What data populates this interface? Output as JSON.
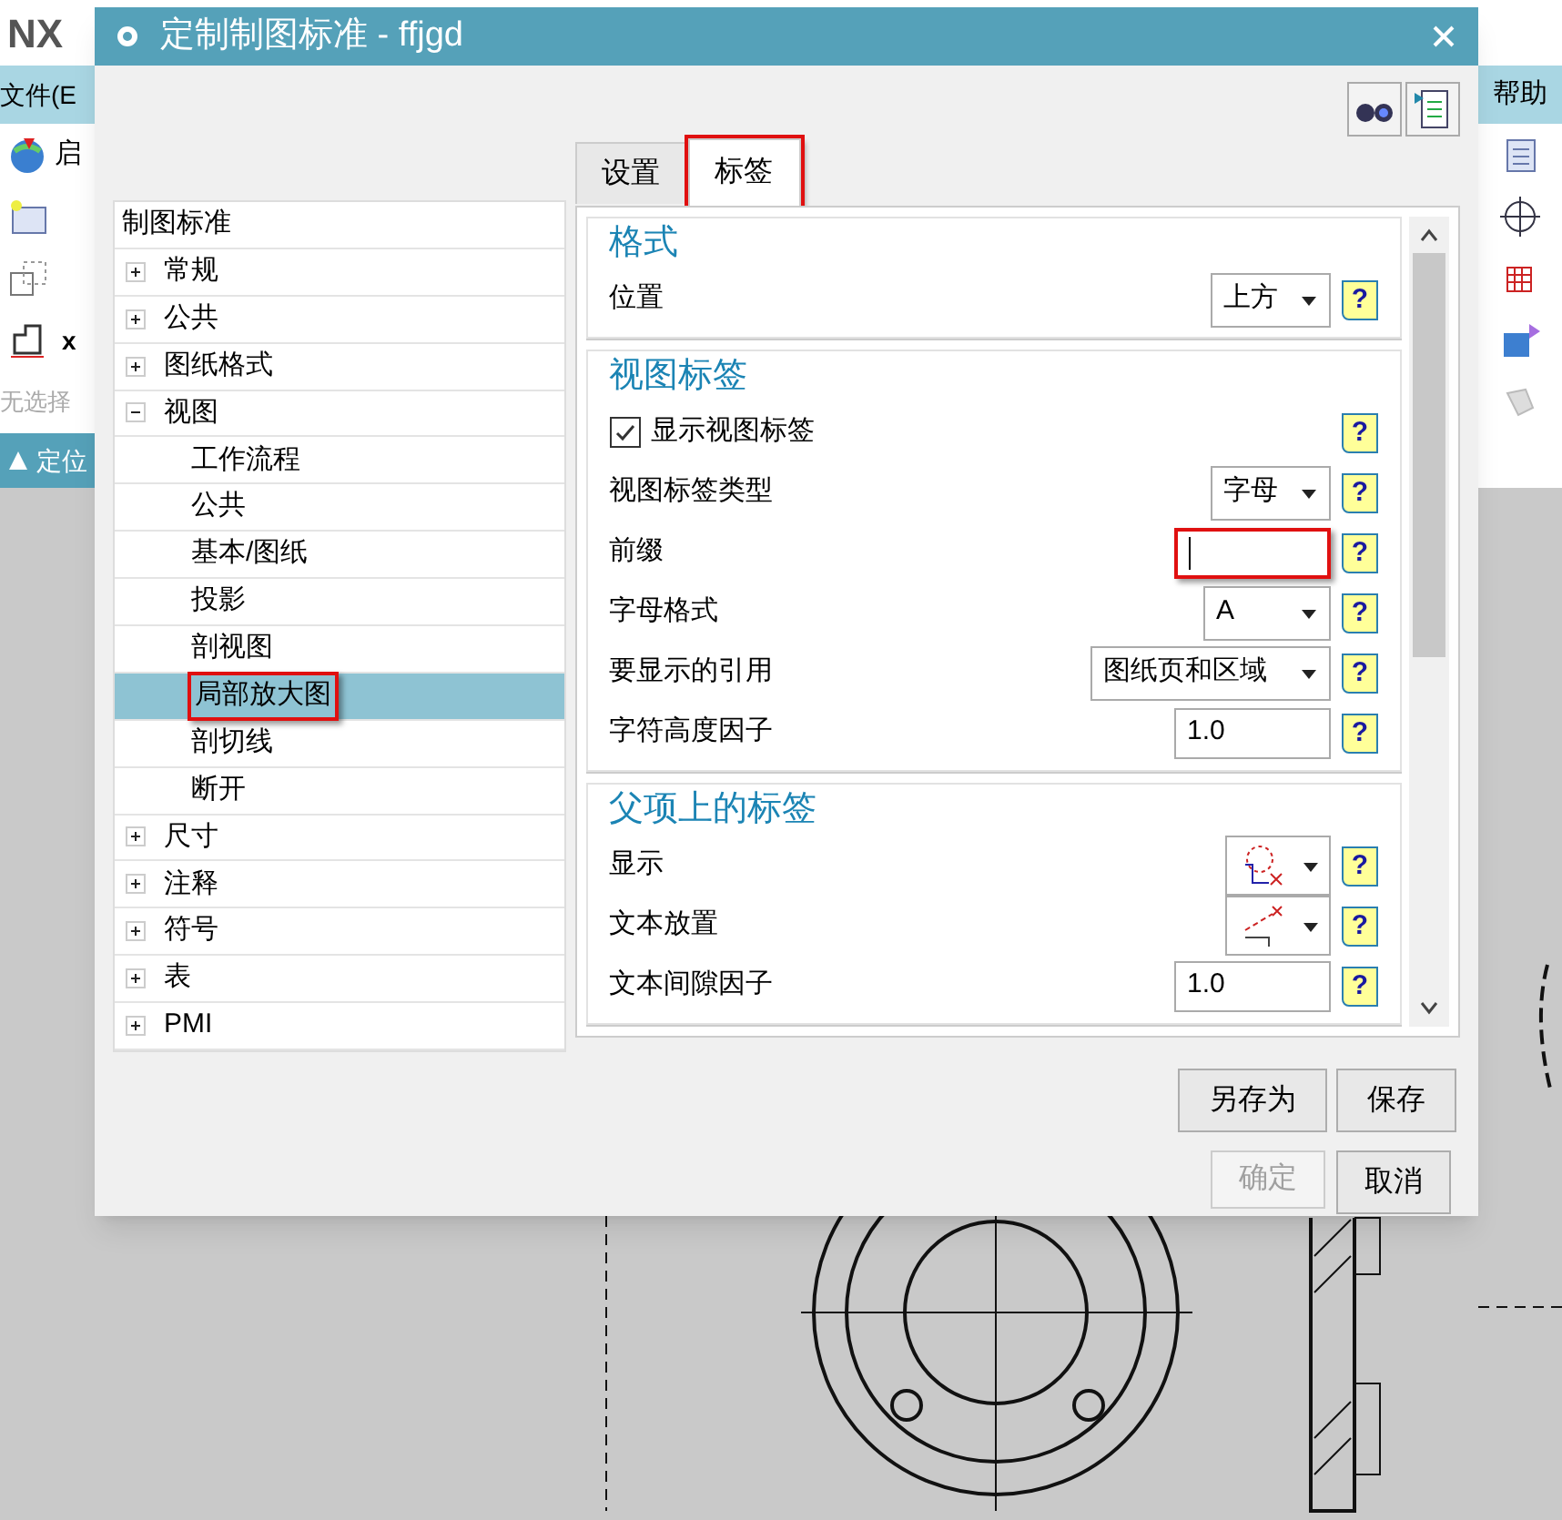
{
  "app": {
    "logo": "NX",
    "menu_left": "文件(E",
    "menu_right": "帮助",
    "start_label": "启",
    "toolbar_text": "x",
    "selection_hint": "无选择",
    "panel_label": "定位"
  },
  "dialog": {
    "title": "定制制图标准 - ffjgd",
    "tree": {
      "header": "制图标准",
      "items": [
        {
          "label": "常规",
          "expanded": false,
          "selected": false
        },
        {
          "label": "公共",
          "expanded": false,
          "selected": false
        },
        {
          "label": "图纸格式",
          "expanded": false,
          "selected": false
        },
        {
          "label": "视图",
          "expanded": true,
          "selected": false,
          "children": [
            {
              "label": "工作流程",
              "selected": false
            },
            {
              "label": "公共",
              "selected": false
            },
            {
              "label": "基本/图纸",
              "selected": false
            },
            {
              "label": "投影",
              "selected": false
            },
            {
              "label": "剖视图",
              "selected": false
            },
            {
              "label": "局部放大图",
              "selected": true,
              "highlighted": true
            },
            {
              "label": "剖切线",
              "selected": false
            },
            {
              "label": "断开",
              "selected": false
            }
          ]
        },
        {
          "label": "尺寸",
          "expanded": false,
          "selected": false
        },
        {
          "label": "注释",
          "expanded": false,
          "selected": false
        },
        {
          "label": "符号",
          "expanded": false,
          "selected": false
        },
        {
          "label": "表",
          "expanded": false,
          "selected": false
        },
        {
          "label": "PMI",
          "expanded": false,
          "selected": false
        }
      ]
    },
    "tabs": [
      {
        "label": "设置",
        "selected": false,
        "highlighted": false
      },
      {
        "label": "标签",
        "selected": true,
        "highlighted": true
      }
    ],
    "sections": [
      {
        "title": "格式",
        "rows": [
          {
            "kind": "dropdown",
            "label": "位置",
            "value": "上方",
            "help": "?"
          }
        ]
      },
      {
        "title": "视图标签",
        "rows": [
          {
            "kind": "checkbox",
            "label": "显示视图标签",
            "checked": true,
            "help": "?"
          },
          {
            "kind": "dropdown",
            "label": "视图标签类型",
            "value": "字母",
            "help": "?"
          },
          {
            "kind": "input",
            "label": "前缀",
            "value": "",
            "highlighted": true,
            "help": "?"
          },
          {
            "kind": "dropdown",
            "label": "字母格式",
            "value": "A",
            "help": "?"
          },
          {
            "kind": "dropdown",
            "label": "要显示的引用",
            "value": "图纸页和区域",
            "help": "?"
          },
          {
            "kind": "input",
            "label": "字符高度因子",
            "value": "1.0",
            "highlighted": false,
            "help": "?"
          }
        ]
      },
      {
        "title": "父项上的标签",
        "rows": [
          {
            "kind": "icon_dropdown",
            "label": "显示",
            "help": "?"
          },
          {
            "kind": "icon_dropdown",
            "label": "文本放置",
            "help": "?"
          },
          {
            "kind": "input",
            "label": "文本间隙因子",
            "value": "1.0",
            "highlighted": false,
            "help": "?"
          }
        ]
      }
    ],
    "actions": [
      {
        "label": "另存为",
        "disabled": false
      },
      {
        "label": "保存",
        "disabled": false
      }
    ],
    "buttons": [
      {
        "label": "确定",
        "disabled": true
      },
      {
        "label": "取消",
        "disabled": false
      }
    ]
  }
}
